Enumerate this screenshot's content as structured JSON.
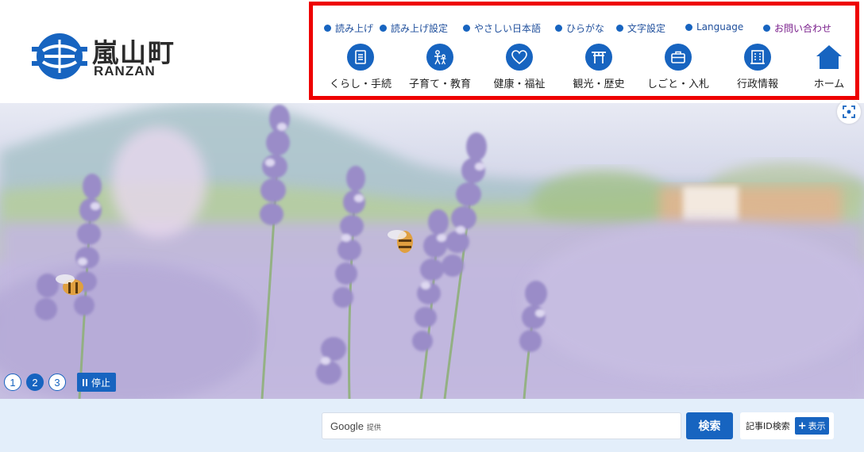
{
  "site": {
    "name_jp": "嵐山町",
    "name_en": "RANZAN",
    "brand_color": "#1764c0",
    "highlight_color": "#ee0000"
  },
  "utility_links": [
    {
      "label": "読み上げ",
      "icon": "dot-icon"
    },
    {
      "label": "読み上げ設定",
      "icon": "dot-icon"
    },
    {
      "label": "やさしい日本語",
      "icon": "dot-icon"
    },
    {
      "label": "ひらがな",
      "icon": "dot-icon"
    },
    {
      "label": "文字設定",
      "icon": "dot-icon"
    },
    {
      "label": "Language",
      "icon": "dot-icon"
    },
    {
      "label": "お問い合わせ",
      "icon": "dot-icon"
    }
  ],
  "main_nav": [
    {
      "label": "くらし・手続",
      "icon": "document-icon"
    },
    {
      "label": "子育て・教育",
      "icon": "parent-child-icon"
    },
    {
      "label": "健康・福祉",
      "icon": "heart-icon"
    },
    {
      "label": "観光・歴史",
      "icon": "torii-icon"
    },
    {
      "label": "しごと・入札",
      "icon": "briefcase-icon"
    },
    {
      "label": "行政情報",
      "icon": "building-icon"
    },
    {
      "label": "ホーム",
      "icon": "home-icon"
    }
  ],
  "slider": {
    "dots": [
      "1",
      "2",
      "3"
    ],
    "active_index": 1,
    "pause_label": "停止"
  },
  "search": {
    "brand": "Google",
    "brand_suffix": "提供",
    "button_label": "検索",
    "article_id_label": "記事ID検索",
    "show_button_label": "表示",
    "show_button_icon": "+"
  }
}
